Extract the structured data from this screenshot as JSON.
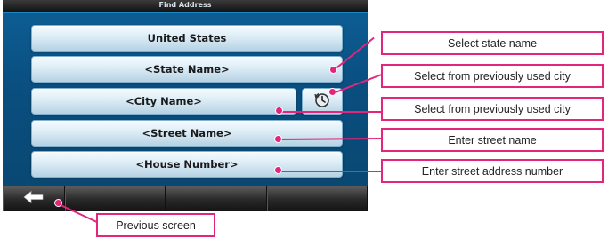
{
  "screen": {
    "title": "Find Address",
    "fields": {
      "country": "United States",
      "state": "<State Name>",
      "city": "<City Name>",
      "street": "<Street Name>",
      "house": "<House Number>"
    },
    "recent_city_icon": "clock-icon",
    "back_icon": "back-arrow-icon"
  },
  "callouts": {
    "state": "Select state name",
    "recent_city_1": "Select from previously used city",
    "recent_city_2": "Select from previously used city",
    "street": "Enter street name",
    "house": "Enter street address number",
    "previous": "Previous screen"
  },
  "colors": {
    "accent": "#e3257c",
    "screen_bg": "#0a4f80"
  }
}
